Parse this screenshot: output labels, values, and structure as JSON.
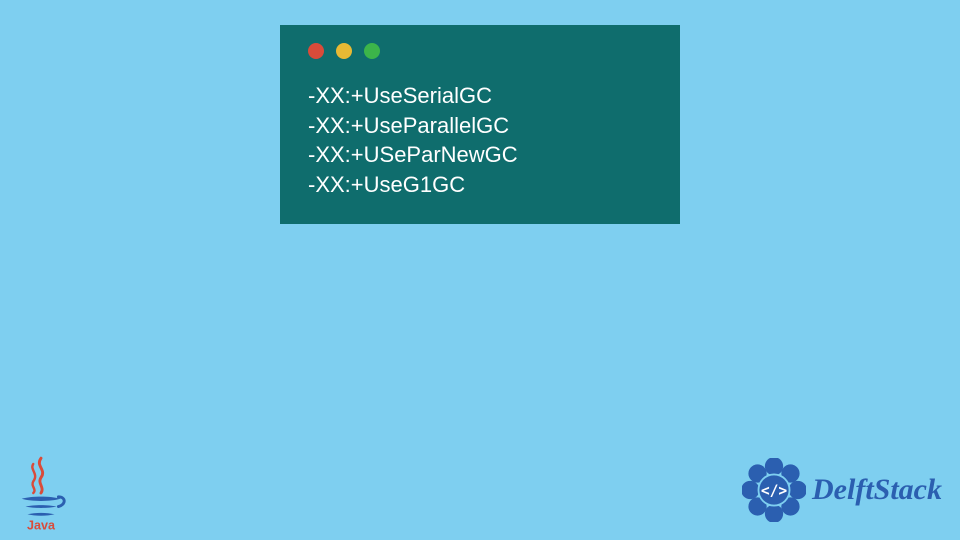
{
  "code": {
    "lines": [
      "-XX:+UseSerialGC",
      "-XX:+UseParallelGC",
      "-XX:+USeParNewGC",
      "-XX:+UseG1GC"
    ]
  },
  "logos": {
    "java_label": "Java",
    "delft_label": "DelftStack"
  }
}
